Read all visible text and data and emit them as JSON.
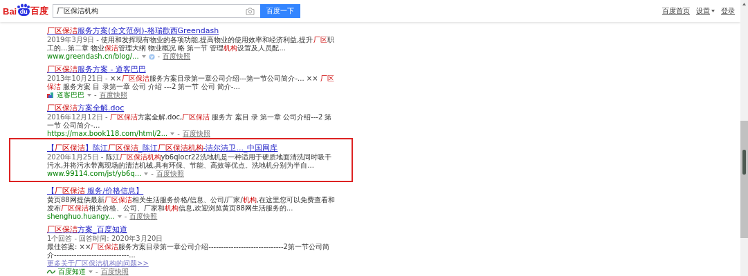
{
  "header": {
    "logo": {
      "left": "Bai",
      "paw": "du",
      "right": "百度"
    },
    "search": {
      "value": "厂区保洁机构"
    },
    "search_button": "百度一下",
    "links": [
      {
        "label": "百度首页",
        "dropdown": false
      },
      {
        "label": "设置",
        "dropdown": true
      },
      {
        "label": "登录",
        "dropdown": false
      }
    ]
  },
  "results": [
    {
      "boxed": false,
      "title": [
        {
          "text": "厂区保洁",
          "highlight": true
        },
        {
          "text": "服务方案(全文范例)-格瑞歡西Greendash",
          "highlight": false
        }
      ],
      "snippet": [
        {
          "text": "2019年3月9日 - ",
          "highlight": false,
          "kind": "date"
        },
        {
          "text": "使用和发挥现有物业的各项功能,提高物业的使用效率和经济利益,提升",
          "highlight": false
        },
        {
          "text": "厂区",
          "highlight": true
        },
        {
          "text": "职工的...第二章 物业",
          "highlight": false
        },
        {
          "text": "保洁",
          "highlight": true
        },
        {
          "text": "管理大纲 物业概况 略 第一节 管理",
          "highlight": false
        },
        {
          "text": "机构",
          "highlight": true
        },
        {
          "text": "设置及人员配...",
          "highlight": false
        }
      ],
      "source": {
        "text": "www.greendash.cn/blog/...",
        "kind": "plain"
      },
      "badge": true,
      "separator": "-",
      "cache": "百度快照"
    },
    {
      "boxed": false,
      "title": [
        {
          "text": "厂区保洁",
          "highlight": true
        },
        {
          "text": "服务方案 - 道客巴巴",
          "highlight": false
        }
      ],
      "snippet": [
        {
          "text": "2013年10月21日 - ",
          "highlight": false,
          "kind": "date"
        },
        {
          "text": "××",
          "highlight": false
        },
        {
          "text": "厂区保洁",
          "highlight": true
        },
        {
          "text": "服务方案目录第一章公司介绍---第一节公司简介-... ×× ",
          "highlight": false
        },
        {
          "text": "厂区保洁",
          "highlight": true
        },
        {
          "text": " 服务方案 目 录第一章 公司 介绍 ---2 第一节 公司 简介-...",
          "highlight": false
        }
      ],
      "source": {
        "text": "道客巴巴",
        "kind": "docin"
      },
      "badge": false,
      "separator": "-",
      "cache": "百度快照"
    },
    {
      "boxed": false,
      "title": [
        {
          "text": "厂区保洁",
          "highlight": true
        },
        {
          "text": "方案全解.doc",
          "highlight": false
        }
      ],
      "snippet": [
        {
          "text": "2016年12月12日 - ",
          "highlight": false,
          "kind": "date"
        },
        {
          "text": "厂区保洁",
          "highlight": true
        },
        {
          "text": "方案全解.doc,",
          "highlight": false
        },
        {
          "text": "厂区保洁",
          "highlight": true
        },
        {
          "text": " 服务方 案目 录 第一章 公司介绍---2 第一节 公司简介-...",
          "highlight": false
        }
      ],
      "source": {
        "text": "https://max.book118.com/html/2...",
        "kind": "plain"
      },
      "badge": false,
      "separator": "-",
      "cache": "百度快照"
    },
    {
      "boxed": true,
      "title": [
        {
          "text": "【",
          "highlight": false
        },
        {
          "text": "厂区保洁",
          "highlight": true
        },
        {
          "text": "】陈江",
          "highlight": false
        },
        {
          "text": "厂区保洁",
          "highlight": true
        },
        {
          "text": "_陈江",
          "highlight": false
        },
        {
          "text": "厂区保洁机构",
          "highlight": true
        },
        {
          "text": "-洁尔清卫..._中国网库",
          "highlight": false
        }
      ],
      "snippet": [
        {
          "text": "2020年1月25日 - ",
          "highlight": false,
          "kind": "date"
        },
        {
          "text": "陈江",
          "highlight": false
        },
        {
          "text": "厂区保洁机构",
          "highlight": true
        },
        {
          "text": "yb6qlocr22洗地机是一种适用于硬质地面清洗同时吸干污水,并将污水带离现场的清洁机械,具有环保、节能、高效等优点。洗地机分别为半自...",
          "highlight": false
        }
      ],
      "source": {
        "text": "www.99114.com/jst/yb6q...",
        "kind": "plain"
      },
      "badge": false,
      "separator": "-",
      "cache": "百度快照"
    },
    {
      "boxed": false,
      "title": [
        {
          "text": "【",
          "highlight": false
        },
        {
          "text": "厂区保洁",
          "highlight": true
        },
        {
          "text": " 服务/价格信息】",
          "highlight": false
        }
      ],
      "snippet": [
        {
          "text": "黄页88网提供最新",
          "highlight": false
        },
        {
          "text": "厂区保洁",
          "highlight": true
        },
        {
          "text": "相关生活服务价格/信息、公司/厂家/",
          "highlight": false
        },
        {
          "text": "机构",
          "highlight": true
        },
        {
          "text": ",在这里您可以免费查看和发布",
          "highlight": false
        },
        {
          "text": "厂区保洁",
          "highlight": true
        },
        {
          "text": "相关价格、公司、厂家和",
          "highlight": false
        },
        {
          "text": "机构",
          "highlight": true
        },
        {
          "text": "信息,欢迎浏览黄页88网生活服务的...",
          "highlight": false
        }
      ],
      "source": {
        "text": "shenghuo.huangy...",
        "kind": "plain"
      },
      "badge": false,
      "separator": "-",
      "cache": "百度快照"
    },
    {
      "boxed": false,
      "title": [
        {
          "text": "厂区保洁",
          "highlight": true
        },
        {
          "text": "方案_百度知道",
          "highlight": false
        }
      ],
      "meta": "1个回答 - 回答时间: 2020年3月20日",
      "snippet": [
        {
          "text": "最佳答案: ××",
          "highlight": false
        },
        {
          "text": "厂区保洁",
          "highlight": true
        },
        {
          "text": "服务方案目录第一章公司介绍------------------------------2第一节公司简介------------------------------...",
          "highlight": false
        }
      ],
      "more_link": "更多关于厂区保洁机构的问题>>",
      "source": {
        "text": "百度知道",
        "kind": "zhidao"
      },
      "badge": false,
      "separator": "-",
      "cache": "百度快照"
    }
  ]
}
